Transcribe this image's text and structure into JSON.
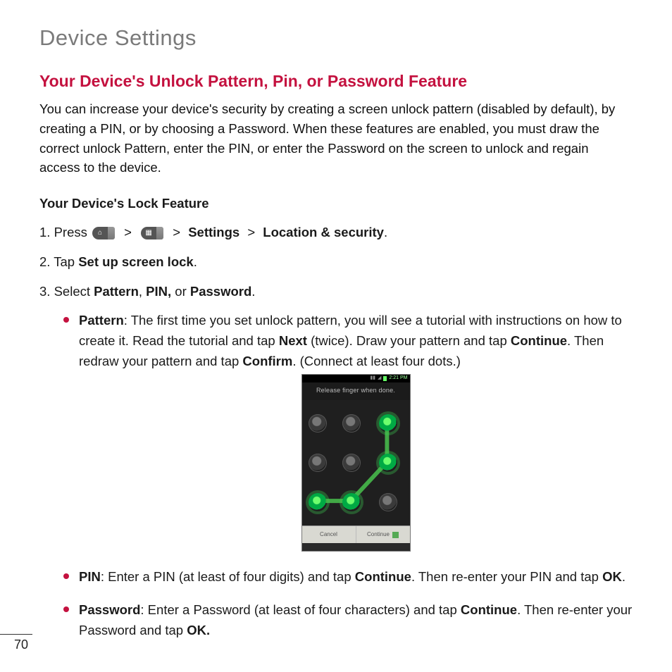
{
  "page": {
    "chapterTitle": "Device Settings",
    "sectionTitle": "Your Device's Unlock Pattern, Pin, or Password Feature",
    "intro": "You can increase your device's security by creating a screen unlock pattern (disabled by default), by creating a PIN, or by choosing a Password. When these features are enabled, you must draw the correct unlock Pattern, enter the PIN, or enter the Password on the screen to unlock and regain access to the device.",
    "subhead": "Your Device's Lock Feature",
    "pageNumber": "70"
  },
  "steps": {
    "s1_a": "Press",
    "s1_gt": ">",
    "s1_settings": "Settings",
    "s1_location": "Location & security",
    "s1_end": ".",
    "s2_a": "Tap ",
    "s2_b": "Set up screen lock",
    "s2_c": ".",
    "s3_a": "Select ",
    "s3_pattern": "Pattern",
    "s3_comma": ", ",
    "s3_pin": "PIN,",
    "s3_or": " or ",
    "s3_password": "Password",
    "s3_end": "."
  },
  "bullets": {
    "pattern_label": "Pattern",
    "pattern_a": ": The first time you set unlock pattern, you will see a tutorial with instructions on how to create it. Read the tutorial and tap ",
    "pattern_next": "Next",
    "pattern_b": " (twice). Draw your pattern and tap ",
    "pattern_cont": "Continue",
    "pattern_c": ". Then redraw your pattern and tap ",
    "pattern_conf": "Confirm",
    "pattern_d": ". (Connect at least four dots.)",
    "pin_label": "PIN",
    "pin_a": ": Enter a PIN (at least of four digits) and tap ",
    "pin_cont": "Continue",
    "pin_b": ". Then re-enter your PIN and tap ",
    "pin_ok": "OK",
    "pin_c": ".",
    "pw_label": "Password",
    "pw_a": ": Enter a Password (at least of four characters) and tap ",
    "pw_cont": "Continue",
    "pw_b": ". Then re-enter your Password and tap ",
    "pw_ok": "OK.",
    "pw_c": ""
  },
  "phone": {
    "status_time": "2:21 PM",
    "title": "Release finger when done.",
    "btn_cancel": "Cancel",
    "btn_continue": "Continue"
  },
  "icons": {
    "home_name": "home-key-icon",
    "apps_name": "apps-key-icon"
  }
}
